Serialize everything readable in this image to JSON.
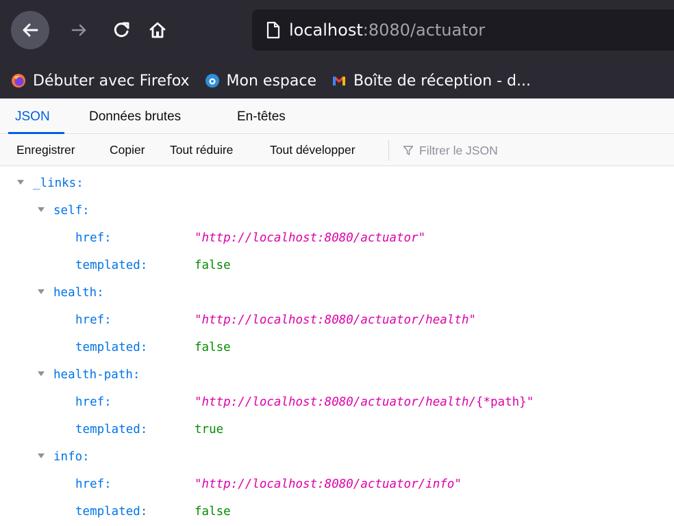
{
  "browser": {
    "url_host": "localhost",
    "url_rest": ":8080/actuator",
    "bookmarks": [
      {
        "label": "Débuter avec Firefox",
        "icon": "firefox-icon"
      },
      {
        "label": "Mon espace",
        "icon": "mon-espace-icon"
      },
      {
        "label": "Boîte de réception - d...",
        "icon": "gmail-icon"
      }
    ]
  },
  "viewer": {
    "tabs": [
      "JSON",
      "Données brutes",
      "En-têtes"
    ],
    "actions": [
      "Enregistrer",
      "Copier",
      "Tout réduire",
      "Tout développer"
    ],
    "filter_placeholder": "Filtrer le JSON"
  },
  "json": {
    "root_key": "_links:",
    "href_label": "href:",
    "templated_label": "templated:",
    "quote": "\"",
    "entries": [
      {
        "key": "self:",
        "href": "http://localhost:8080/actuator",
        "href_suffix": "",
        "templated": "false"
      },
      {
        "key": "health:",
        "href": "http://localhost:8080/actuator/health",
        "href_suffix": "",
        "templated": "false"
      },
      {
        "key": "health-path:",
        "href": "http://localhost:8080/actuator/health/",
        "href_suffix": "{*path}",
        "templated": "true"
      },
      {
        "key": "info:",
        "href": "http://localhost:8080/actuator/info",
        "href_suffix": "",
        "templated": "false"
      }
    ]
  },
  "colors": {
    "toolbar": "#2b2a33",
    "accent": "#0060df",
    "json_key": "#0074e8",
    "json_string": "#dd00a9",
    "json_boolean": "#058b00"
  }
}
